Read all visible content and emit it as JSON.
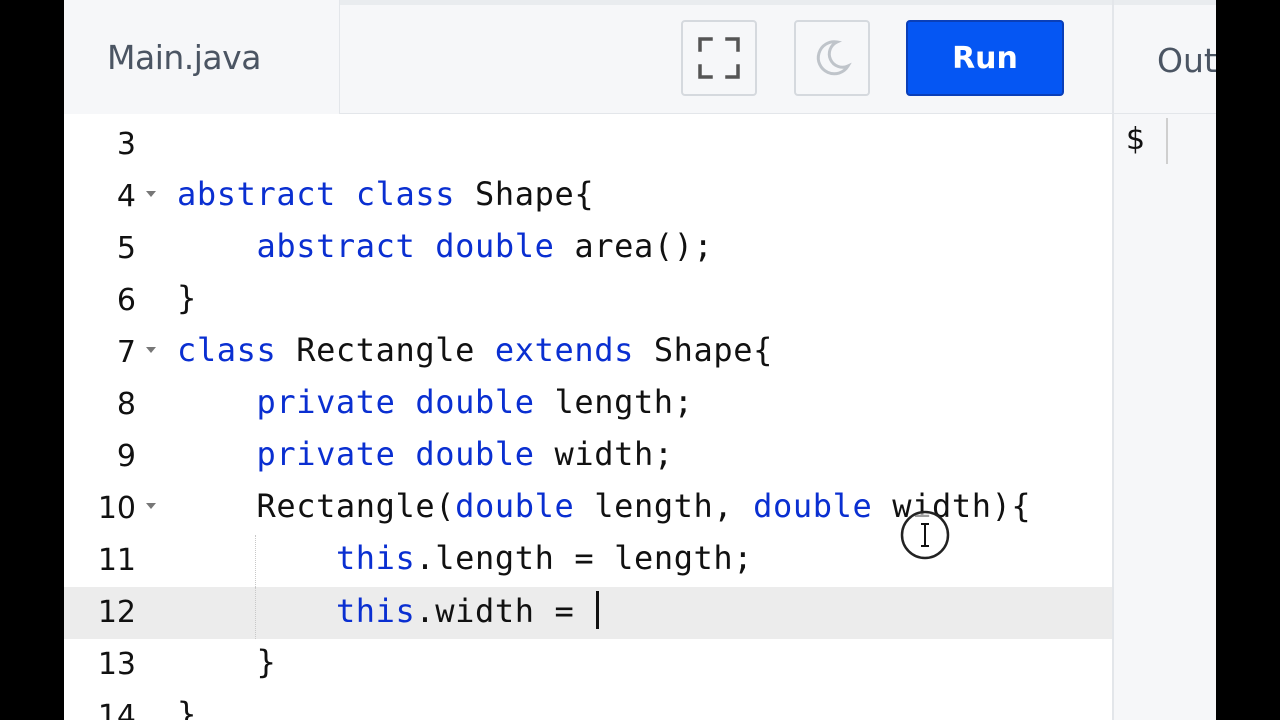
{
  "editor": {
    "file_tab": "Main.java",
    "toolbar": {
      "fullscreen_icon": "fullscreen-icon",
      "theme_icon": "moon-icon",
      "run_label": "Run"
    }
  },
  "output": {
    "title": "Out",
    "prompt": "$"
  },
  "code_lines": [
    {
      "n": "3",
      "text": ""
    },
    {
      "n": "4",
      "text": "abstract class Shape{"
    },
    {
      "n": "5",
      "text": "    abstract double area();"
    },
    {
      "n": "6",
      "text": "}"
    },
    {
      "n": "7",
      "text": "class Rectangle extends Shape{"
    },
    {
      "n": "8",
      "text": "    private double length;"
    },
    {
      "n": "9",
      "text": "    private double width;"
    },
    {
      "n": "10",
      "text": "    Rectangle(double length, double width){"
    },
    {
      "n": "11",
      "text": "        this.length = length;"
    },
    {
      "n": "12",
      "text": "        this.width = "
    },
    {
      "n": "13",
      "text": "    }"
    },
    {
      "n": "14",
      "text": "}"
    }
  ],
  "colors": {
    "keyword": "#0a2fd1",
    "run_button": "#0556f3",
    "active_line": "#ececec"
  }
}
